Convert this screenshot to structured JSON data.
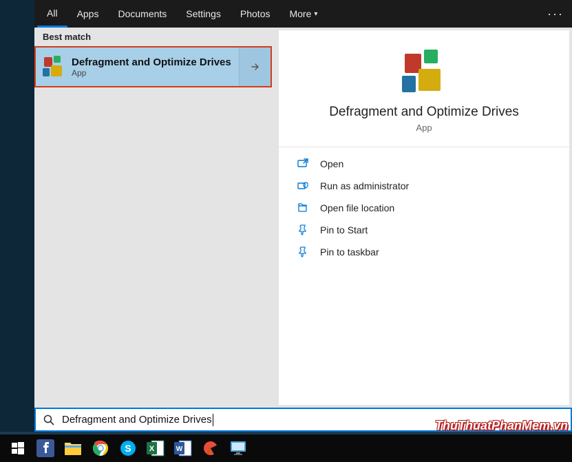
{
  "tabs": {
    "all": "All",
    "apps": "Apps",
    "documents": "Documents",
    "settings": "Settings",
    "photos": "Photos",
    "more": "More"
  },
  "section_best_match": "Best match",
  "best_match": {
    "title": "Defragment and Optimize Drives",
    "subtitle": "App"
  },
  "detail": {
    "title": "Defragment and Optimize Drives",
    "subtitle": "App",
    "actions": {
      "open": "Open",
      "run_admin": "Run as administrator",
      "open_loc": "Open file location",
      "pin_start": "Pin to Start",
      "pin_taskbar": "Pin to taskbar"
    }
  },
  "search_query": "Defragment and Optimize Drives",
  "watermark": "ThuThuatPhanMem.vn"
}
